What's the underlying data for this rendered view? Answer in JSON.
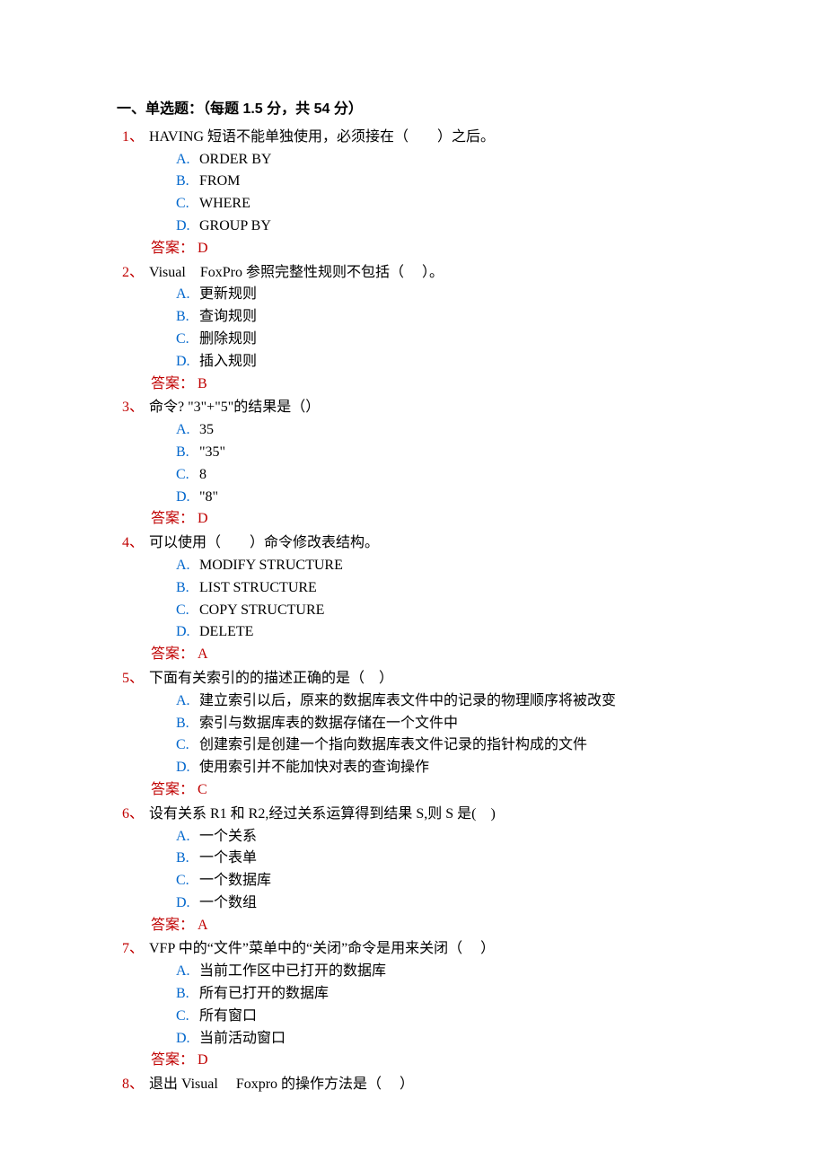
{
  "section_title": "一、单选题：（每题 1.5 分，共 54 分）",
  "answer_prefix": "答案：",
  "questions": [
    {
      "num": "1、",
      "text": " HAVING 短语不能单独使用，必须接在（　　）之后。",
      "options": [
        {
          "label": "A.",
          "text": "ORDER BY"
        },
        {
          "label": "B.",
          "text": "FROM"
        },
        {
          "label": "C.",
          "text": "WHERE"
        },
        {
          "label": "D.",
          "text": "GROUP BY"
        }
      ],
      "answer": " D"
    },
    {
      "num": "2、",
      "text": " Visual　FoxPro 参照完整性规则不包括（　 ）。",
      "options": [
        {
          "label": "A.",
          "text": "更新规则"
        },
        {
          "label": "B.",
          "text": "查询规则"
        },
        {
          "label": "C.",
          "text": "删除规则"
        },
        {
          "label": "D.",
          "text": "插入规则"
        }
      ],
      "answer": " B"
    },
    {
      "num": "3、",
      "text": " 命令? \"3\"+\"5\"的结果是（）",
      "options": [
        {
          "label": "A.",
          "text": "35"
        },
        {
          "label": "B.",
          "text": "\"35\""
        },
        {
          "label": "C.",
          "text": "8"
        },
        {
          "label": "D.",
          "text": "\"8\""
        }
      ],
      "answer": " D"
    },
    {
      "num": "4、",
      "text": " 可以使用（　　）命令修改表结构。",
      "options": [
        {
          "label": "A.",
          "text": "MODIFY STRUCTURE"
        },
        {
          "label": "B.",
          "text": "LIST STRUCTURE"
        },
        {
          "label": "C.",
          "text": "COPY STRUCTURE"
        },
        {
          "label": "D.",
          "text": "DELETE"
        }
      ],
      "answer": " A"
    },
    {
      "num": "5、",
      "text": " 下面有关索引的的描述正确的是（　）",
      "options": [
        {
          "label": "A.",
          "text": "建立索引以后，原来的数据库表文件中的记录的物理顺序将被改变"
        },
        {
          "label": "B.",
          "text": "索引与数据库表的数据存储在一个文件中"
        },
        {
          "label": "C.",
          "text": "创建索引是创建一个指向数据库表文件记录的指针构成的文件"
        },
        {
          "label": "D.",
          "text": "使用索引并不能加快对表的查询操作"
        }
      ],
      "answer": " C"
    },
    {
      "num": "6、",
      "text": " 设有关系 R1 和 R2,经过关系运算得到结果 S,则 S 是(　)",
      "options": [
        {
          "label": "A.",
          "text": "一个关系"
        },
        {
          "label": "B.",
          "text": "一个表单"
        },
        {
          "label": "C.",
          "text": "一个数据库"
        },
        {
          "label": "D.",
          "text": "一个数组"
        }
      ],
      "answer": " A"
    },
    {
      "num": "7、",
      "text": " VFP 中的“文件”菜单中的“关闭”命令是用来关闭（　 ）",
      "options": [
        {
          "label": "A.",
          "text": "当前工作区中已打开的数据库"
        },
        {
          "label": "B.",
          "text": "所有已打开的数据库"
        },
        {
          "label": "C.",
          "text": "所有窗口"
        },
        {
          "label": "D.",
          "text": "当前活动窗口"
        }
      ],
      "answer": " D"
    },
    {
      "num": "8、",
      "text": " 退出 Visual　 Foxpro 的操作方法是（　 ）",
      "options": [],
      "answer": null
    }
  ]
}
